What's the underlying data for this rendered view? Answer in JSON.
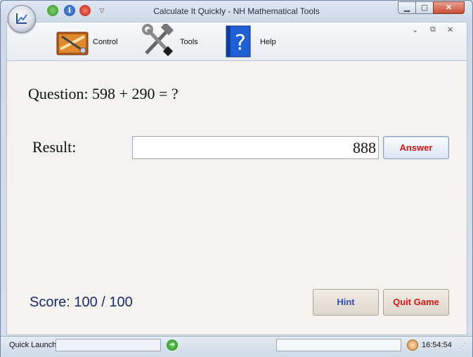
{
  "window": {
    "title": "Calculate It Quickly - NH Mathematical Tools",
    "minimize_glyph": "▁",
    "maximize_glyph": "▢",
    "close_glyph": "✕"
  },
  "quick_access": {
    "info_glyph": "i",
    "menu_glyph": "▽"
  },
  "ribbon": {
    "items": [
      {
        "label": "Control",
        "icon": "control-panel-icon"
      },
      {
        "label": "Tools",
        "icon": "hammer-wrench-icon"
      },
      {
        "label": "Help",
        "icon": "help-book-icon"
      }
    ],
    "controls": {
      "collapse": "⌄",
      "restore": "⧉",
      "close": "✕"
    }
  },
  "game": {
    "question": "Question:  598 + 290 = ?",
    "result_label": "Result:",
    "result_value": "888",
    "answer_button": "Answer",
    "score": "Score: 100 / 100",
    "hint_button": "Hint",
    "quit_button": "Quit Game"
  },
  "statusbar": {
    "quick_launch_label": "Quick Launch",
    "quick_launch_value": "",
    "go_glyph": "➜",
    "time": "16:54:54",
    "grip_glyph": "⋰"
  },
  "colors": {
    "answer_text": "#dd1111",
    "hint_text": "#3049b8",
    "score_text": "#1a2a6c"
  }
}
